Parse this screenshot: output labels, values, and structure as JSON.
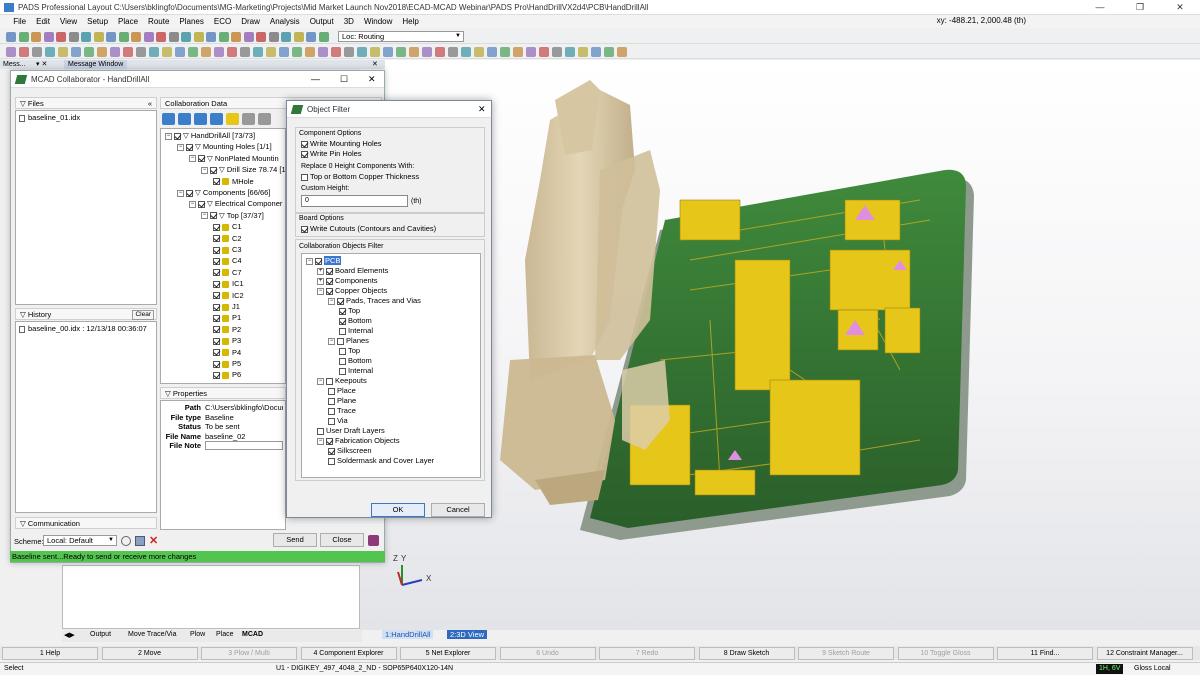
{
  "app": {
    "title": "PADS Professional Layout  C:\\Users\\bklingfo\\Documents\\MG-Marketing\\Projects\\Mid Market Launch Nov2018\\ECAD-MCAD Webinar\\PADS Pro\\HandDrillVX2d4\\PCB\\HandDrillAll",
    "coords": "xy: -488.21, 2,000.48 (th)",
    "win_min": "—",
    "win_max": "❐",
    "win_close": "✕"
  },
  "menu": [
    "File",
    "Edit",
    "View",
    "Setup",
    "Place",
    "Route",
    "Planes",
    "ECO",
    "Draw",
    "Analysis",
    "Output",
    "3D",
    "Window",
    "Help"
  ],
  "toolbar": {
    "loc_combo": "Loc: Routing"
  },
  "msgtabs": {
    "left": "Mess...",
    "pin": "▾ ✕",
    "right": "Message Window",
    "rpin": "✕"
  },
  "mcad": {
    "title": "MCAD Collaborator - HandDrillAll",
    "files_label": "Files",
    "files": [
      "baseline_01.idx"
    ],
    "history_label": "History",
    "clear_label": "Clear",
    "history": [
      "baseline_00.idx : 12/13/18 00:36:07"
    ],
    "communication_label": "Communication",
    "collab_label": "Collaboration Data",
    "tree": [
      {
        "label": "HandDrillAll [73/73]",
        "indent": 0,
        "exp": "−"
      },
      {
        "label": "Mounting Holes [1/1]",
        "indent": 1,
        "exp": "−"
      },
      {
        "label": "NonPlated Mountin",
        "indent": 2,
        "exp": "−"
      },
      {
        "label": "Drill Size 78.74 [1",
        "indent": 3,
        "exp": "−"
      },
      {
        "label": "MHole",
        "indent": 4,
        "exp": ""
      },
      {
        "label": "Components [66/66]",
        "indent": 1,
        "exp": "−"
      },
      {
        "label": "Electrical Componer",
        "indent": 2,
        "exp": "−"
      },
      {
        "label": "Top [37/37]",
        "indent": 3,
        "exp": "−"
      },
      {
        "label": "C1",
        "indent": 4,
        "exp": ""
      },
      {
        "label": "C2",
        "indent": 4,
        "exp": ""
      },
      {
        "label": "C3",
        "indent": 4,
        "exp": ""
      },
      {
        "label": "C4",
        "indent": 4,
        "exp": ""
      },
      {
        "label": "C7",
        "indent": 4,
        "exp": ""
      },
      {
        "label": "IC1",
        "indent": 4,
        "exp": ""
      },
      {
        "label": "IC2",
        "indent": 4,
        "exp": ""
      },
      {
        "label": "J1",
        "indent": 4,
        "exp": ""
      },
      {
        "label": "P1",
        "indent": 4,
        "exp": ""
      },
      {
        "label": "P2",
        "indent": 4,
        "exp": ""
      },
      {
        "label": "P3",
        "indent": 4,
        "exp": ""
      },
      {
        "label": "P4",
        "indent": 4,
        "exp": ""
      },
      {
        "label": "P5",
        "indent": 4,
        "exp": ""
      },
      {
        "label": "P6",
        "indent": 4,
        "exp": ""
      }
    ],
    "properties_label": "Properties",
    "properties": [
      {
        "k": "Path",
        "v": "C:\\Users\\bklingfo\\Documen"
      },
      {
        "k": "File type",
        "v": "Baseline"
      },
      {
        "k": "Status",
        "v": "To be sent"
      },
      {
        "k": "File Name",
        "v": "baseline_02"
      },
      {
        "k": "File Note",
        "v": ""
      }
    ],
    "scheme_label": "Scheme:",
    "scheme_value": "Local: Default",
    "send_label": "Send",
    "close_label": "Close",
    "status": "Baseline sent...Ready to send or receive more changes"
  },
  "dialog": {
    "title": "Object Filter",
    "comp_options": "Component Options",
    "write_mounting": "Write Mounting Holes",
    "write_pin": "Write Pin Holes",
    "replace_label": "Replace 0 Height Components With:",
    "top_bottom": "Top or Bottom Copper Thickness",
    "custom_height": "Custom Height:",
    "custom_value": "0",
    "unit": "(th)",
    "board_options": "Board Options",
    "write_cutouts": "Write Cutouts (Contours and Cavities)",
    "filter_label": "Collaboration Objects Filter",
    "filter_tree": [
      {
        "label": "PCB",
        "indent": 0,
        "exp": "−",
        "on": true,
        "sel": true
      },
      {
        "label": "Board Elements",
        "indent": 1,
        "exp": "+",
        "on": true
      },
      {
        "label": "Components",
        "indent": 1,
        "exp": "+",
        "on": true
      },
      {
        "label": "Copper Objects",
        "indent": 1,
        "exp": "−",
        "on": true
      },
      {
        "label": "Pads, Traces and Vias",
        "indent": 2,
        "exp": "−",
        "on": true
      },
      {
        "label": "Top",
        "indent": 3,
        "exp": "",
        "on": true
      },
      {
        "label": "Bottom",
        "indent": 3,
        "exp": "",
        "on": true
      },
      {
        "label": "Internal",
        "indent": 3,
        "exp": "",
        "on": false
      },
      {
        "label": "Planes",
        "indent": 2,
        "exp": "−",
        "on": false
      },
      {
        "label": "Top",
        "indent": 3,
        "exp": "",
        "on": false
      },
      {
        "label": "Bottom",
        "indent": 3,
        "exp": "",
        "on": false
      },
      {
        "label": "Internal",
        "indent": 3,
        "exp": "",
        "on": false
      },
      {
        "label": "Keepouts",
        "indent": 1,
        "exp": "−",
        "on": false
      },
      {
        "label": "Place",
        "indent": 2,
        "exp": "",
        "on": false
      },
      {
        "label": "Plane",
        "indent": 2,
        "exp": "",
        "on": false
      },
      {
        "label": "Trace",
        "indent": 2,
        "exp": "",
        "on": false
      },
      {
        "label": "Via",
        "indent": 2,
        "exp": "",
        "on": false
      },
      {
        "label": "User Draft Layers",
        "indent": 1,
        "exp": "",
        "on": false
      },
      {
        "label": "Fabrication Objects",
        "indent": 1,
        "exp": "−",
        "on": true
      },
      {
        "label": "Silkscreen",
        "indent": 2,
        "exp": "",
        "on": true
      },
      {
        "label": "Soldermask and Cover Layer",
        "indent": 2,
        "exp": "",
        "on": false
      }
    ],
    "ok": "OK",
    "cancel": "Cancel"
  },
  "bottom_tabs": [
    "Output",
    "Move Trace/Via",
    "Plow",
    "Place",
    "MCAD"
  ],
  "view_tabs": [
    "1:HandDrillAll",
    "2:3D View"
  ],
  "axes": {
    "z": "Z",
    "y": "Y",
    "x": "X"
  },
  "fkeys": [
    {
      "label": "1 Help",
      "enabled": true
    },
    {
      "label": "2 Move",
      "enabled": true
    },
    {
      "label": "3 Plow / Multi",
      "enabled": false
    },
    {
      "label": "4 Component Explorer",
      "enabled": true
    },
    {
      "label": "5 Net Explorer",
      "enabled": true
    },
    {
      "label": "6 Undo",
      "enabled": false
    },
    {
      "label": "7 Redo",
      "enabled": false
    },
    {
      "label": "8 Draw Sketch",
      "enabled": true
    },
    {
      "label": "9 Sketch Route",
      "enabled": false
    },
    {
      "label": "10 Toggle Gloss",
      "enabled": false
    },
    {
      "label": "11 Find...",
      "enabled": true
    },
    {
      "label": "12 Constraint Manager...",
      "enabled": true
    }
  ],
  "statusbar": {
    "mode": "Select",
    "part": "U1 - DIGIKEY_497_4048_2_ND - SOP65P640X120-14N",
    "indicator": "1H, 6V",
    "gloss": "Gloss Local"
  },
  "colors": {
    "board": "#2e6b2f",
    "gold": "#e6c619",
    "mech": "#d8c9a4",
    "status_green": "#53c44f"
  }
}
